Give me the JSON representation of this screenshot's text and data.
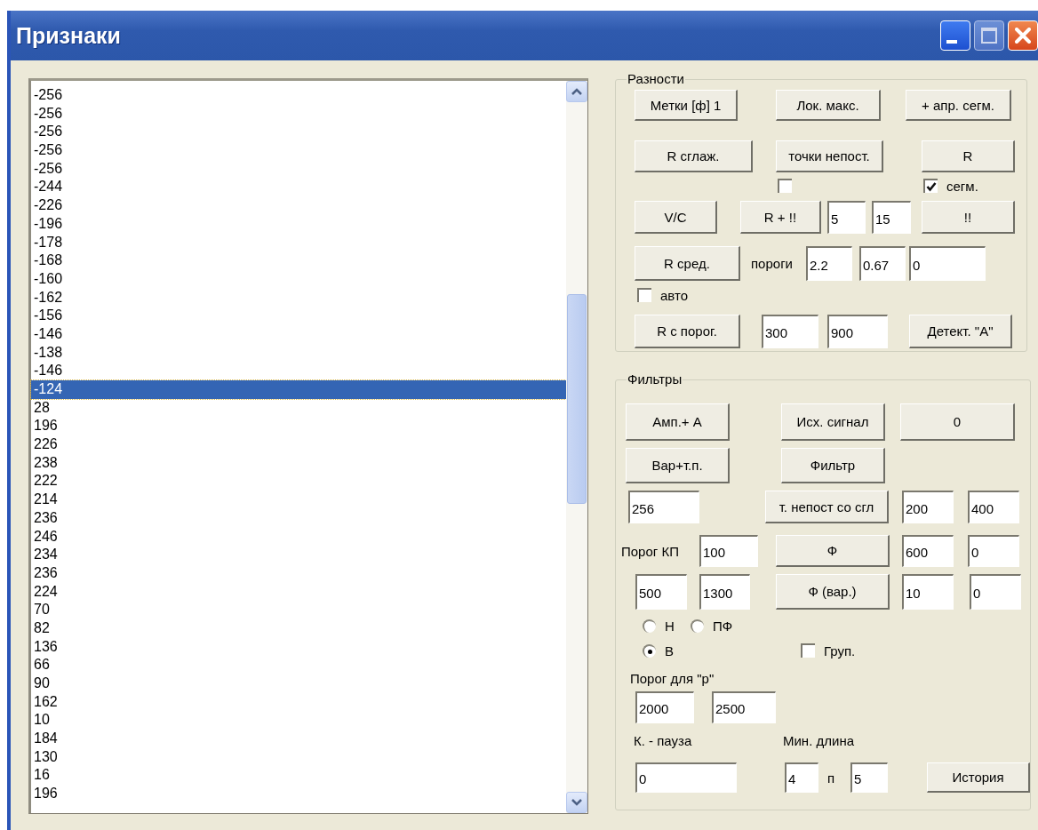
{
  "window": {
    "title": "Признаки"
  },
  "list": {
    "items": [
      {
        "text": "-256",
        "selected": false
      },
      {
        "text": "-256",
        "selected": false
      },
      {
        "text": "-256",
        "selected": false
      },
      {
        "text": "-256",
        "selected": false
      },
      {
        "text": "-256",
        "selected": false
      },
      {
        "text": "-244",
        "selected": false
      },
      {
        "text": "-226",
        "selected": false
      },
      {
        "text": "-196",
        "selected": false
      },
      {
        "text": "-178",
        "selected": false
      },
      {
        "text": "-168",
        "selected": false
      },
      {
        "text": "-160",
        "selected": false
      },
      {
        "text": "-162",
        "selected": false
      },
      {
        "text": "-156",
        "selected": false
      },
      {
        "text": "-146",
        "selected": false
      },
      {
        "text": "-138",
        "selected": false
      },
      {
        "text": "-146",
        "selected": false
      },
      {
        "text": "-124",
        "selected": true
      },
      {
        "text": "28",
        "selected": false
      },
      {
        "text": "196",
        "selected": false
      },
      {
        "text": "226",
        "selected": false
      },
      {
        "text": "238",
        "selected": false
      },
      {
        "text": "222",
        "selected": false
      },
      {
        "text": "214",
        "selected": false
      },
      {
        "text": "236",
        "selected": false
      },
      {
        "text": "246",
        "selected": false
      },
      {
        "text": "234",
        "selected": false
      },
      {
        "text": "236",
        "selected": false
      },
      {
        "text": "224",
        "selected": false
      },
      {
        "text": "70",
        "selected": false
      },
      {
        "text": "82",
        "selected": false
      },
      {
        "text": "136",
        "selected": false
      },
      {
        "text": "66",
        "selected": false
      },
      {
        "text": "90",
        "selected": false
      },
      {
        "text": "162",
        "selected": false
      },
      {
        "text": "10",
        "selected": false
      },
      {
        "text": "184",
        "selected": false
      },
      {
        "text": "130",
        "selected": false
      },
      {
        "text": "16",
        "selected": false
      },
      {
        "text": "196",
        "selected": false
      }
    ]
  },
  "differences": {
    "title": "Разности",
    "controls": [
      {
        "kind": "button",
        "label": "Метки [ф] 1"
      },
      {
        "kind": "button",
        "label": "Лок. макс."
      },
      {
        "kind": "button",
        "label": "+ апр. сегм."
      },
      {
        "kind": "button",
        "label": "R сглаж."
      },
      {
        "kind": "button",
        "label": "точки непост."
      },
      {
        "kind": "button",
        "label": "R"
      },
      {
        "kind": "checkbox",
        "checked": false
      },
      {
        "kind": "checkbox",
        "label": "сегм.",
        "checked": true
      },
      {
        "kind": "button",
        "label": "V/C"
      },
      {
        "kind": "button",
        "label": "R + !!"
      },
      {
        "kind": "input",
        "value": "5"
      },
      {
        "kind": "input",
        "value": "15"
      },
      {
        "kind": "button",
        "label": "!!"
      },
      {
        "kind": "button",
        "label": "R сред."
      },
      {
        "kind": "label",
        "text": "пороги"
      },
      {
        "kind": "input",
        "value": "2.2"
      },
      {
        "kind": "input",
        "value": "0.67"
      },
      {
        "kind": "input",
        "value": "0"
      },
      {
        "kind": "checkbox",
        "label": "авто",
        "checked": false
      },
      {
        "kind": "button",
        "label": "R с порог."
      },
      {
        "kind": "input",
        "value": "300"
      },
      {
        "kind": "input",
        "value": "900"
      },
      {
        "kind": "button",
        "label": "Детект. \"А\""
      }
    ]
  },
  "filters": {
    "title": "Фильтры",
    "controls": [
      {
        "kind": "button",
        "label": "Амп.+ А"
      },
      {
        "kind": "button",
        "label": "Исх. сигнал"
      },
      {
        "kind": "button",
        "label": "0"
      },
      {
        "kind": "button",
        "label": "Вар+т.п."
      },
      {
        "kind": "button",
        "label": "Фильтр"
      },
      {
        "kind": "input",
        "value": "256"
      },
      {
        "kind": "button",
        "label": "т. непост со сгл"
      },
      {
        "kind": "input",
        "value": "200"
      },
      {
        "kind": "input",
        "value": "400"
      },
      {
        "kind": "label",
        "text": "Порог КП"
      },
      {
        "kind": "input",
        "value": "100"
      },
      {
        "kind": "button",
        "label": "Ф"
      },
      {
        "kind": "input",
        "value": "600"
      },
      {
        "kind": "input",
        "value": "0"
      },
      {
        "kind": "input",
        "value": "500"
      },
      {
        "kind": "input",
        "value": "1300"
      },
      {
        "kind": "button",
        "label": "Ф (вар.)"
      },
      {
        "kind": "input",
        "value": "10"
      },
      {
        "kind": "input",
        "value": "0"
      },
      {
        "kind": "radio",
        "label": "Н",
        "selected": false
      },
      {
        "kind": "radio",
        "label": "ПФ",
        "selected": false
      },
      {
        "kind": "radio",
        "label": "В",
        "selected": true
      },
      {
        "kind": "checkbox",
        "label": "Груп.",
        "checked": false
      },
      {
        "kind": "label",
        "text": "Порог для \"р\""
      },
      {
        "kind": "input",
        "value": "2000"
      },
      {
        "kind": "input",
        "value": "2500"
      },
      {
        "kind": "label",
        "text": "К. - пауза"
      },
      {
        "kind": "label",
        "text": "Мин. длина"
      },
      {
        "kind": "input",
        "value": "0"
      },
      {
        "kind": "input",
        "value": "4"
      },
      {
        "kind": "label",
        "text": "п"
      },
      {
        "kind": "input",
        "value": "5"
      },
      {
        "kind": "button",
        "label": "История"
      }
    ]
  }
}
